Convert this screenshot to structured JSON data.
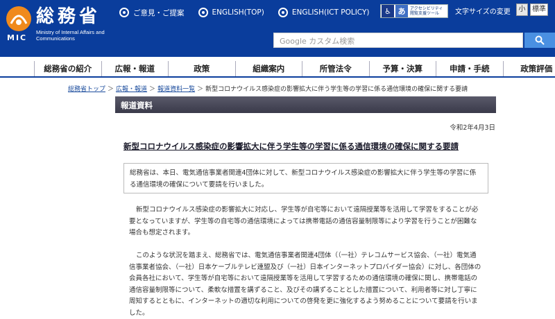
{
  "header": {
    "logo_jp": "総務省",
    "logo_en": "Ministry of Internal Affairs and Communications",
    "logo_mic": "MIC",
    "top_links": [
      "ご意見・ご提案",
      "ENGLISH(TOP)",
      "ENGLISH(ICT POLICY)"
    ],
    "accessibility_label_1": "アクセシビリティ",
    "accessibility_label_2": "閲覧支援ツール",
    "font_size_label": "文字サイズの変更",
    "font_small": "小",
    "font_standard": "標準",
    "search_placeholder": "カスタム検索",
    "search_brand": "Google"
  },
  "nav": {
    "items": [
      "総務省の紹介",
      "広報・報道",
      "政策",
      "組織案内",
      "所管法令",
      "予算・決算",
      "申請・手続",
      "政策評価"
    ]
  },
  "breadcrumb": {
    "items": [
      "総務省トップ",
      "広報・報道",
      "報道資料一覧"
    ],
    "current": "新型コロナウイルス感染症の影響拡大に伴う学生等の学習に係る通信環境の確保に関する要請"
  },
  "section": {
    "title": "報道資料"
  },
  "article": {
    "date": "令和2年4月3日",
    "headline": "新型コロナウイルス感染症の影響拡大に伴う学生等の学習に係る通信環境の確保に関する要請",
    "summary": "総務省は、本日、電気通信事業者関連4団体に対して、新型コロナウイルス感染症の影響拡大に伴う学生等の学習に係る通信環境の確保について要請を行いました。",
    "para1": "新型コロナウイルス感染症の影響拡大に対応し、学生等が自宅等において遠隔授業等を活用して学習をすることが必要となっていますが、学生等の自宅等の通信環境によっては携帯電話の通信容量制限等により学習を行うことが困難な場合も想定されます。",
    "para2": "このような状況を踏まえ、総務省では、電気通信事業者関連4団体（（一社）テレコムサービス協会、（一社）電気通信事業者協会、（一社）日本ケーブルテレビ連盟及び（一社）日本インターネットプロバイダー協会）に対し、各団体の会員各社において、学生等が自宅等において遠隔授業等を活用して学習するための通信環境の確保に関し、携帯電話の通信容量制限等について、柔軟な措置を講ずること、及びその講ずることとした措置について、利用者等に対し丁寧に周知するとともに、インターネットの適切な利用についての啓発を更に強化するよう努めることについて要請を行いました。"
  },
  "colors": {
    "header_bg": "#0a3d9c",
    "search_button": "#4a90e2",
    "section_bar": "#4a4a5a"
  }
}
